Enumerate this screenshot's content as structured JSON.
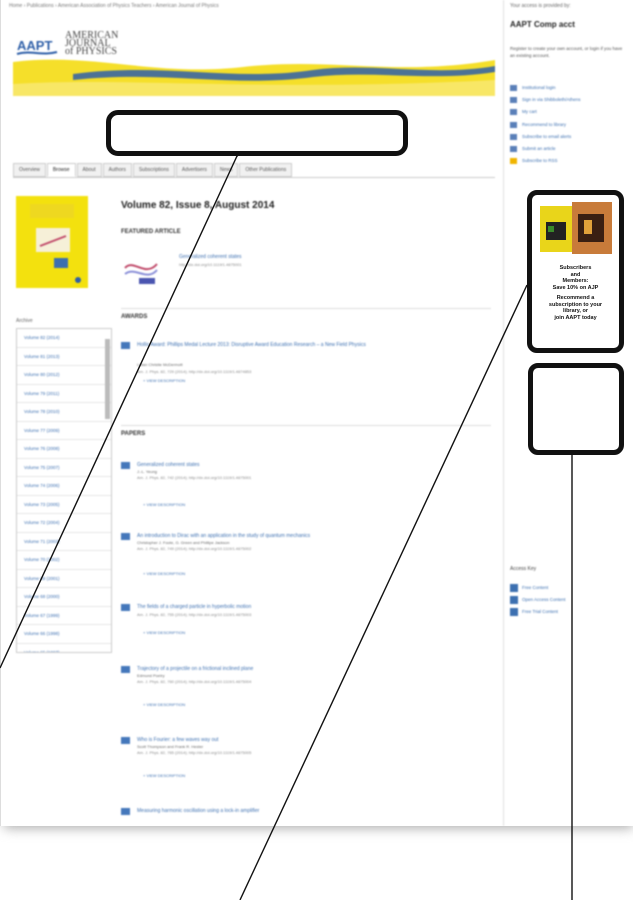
{
  "breadcrumb": "Home › Publications › American Association of Physics Teachers › American Journal of Physics",
  "journal": {
    "logo_text": "AAPT",
    "name_lines": [
      "AMERICAN",
      "JOURNAL",
      "of PHYSICS"
    ]
  },
  "tabs": [
    "Overview",
    "Browse",
    "About",
    "Authors",
    "Subscriptions",
    "Advertisers",
    "News",
    "Other Publications"
  ],
  "main": {
    "volume_title": "Volume 82, Issue 8, August 2014",
    "featured_heading": "FEATURED ARTICLE",
    "featured": {
      "title": "Generalized coherent states",
      "cite": "http://dx.doi.org/10.1119/1.4875001"
    },
    "awards_heading": "AWARDS",
    "award": {
      "title": "Hollis Award: Phillips Medal Lecture 2013: Disruptive Award Education Research – a New Field Physics",
      "authors": "Lillian Christie McDermott",
      "cite": "Am. J. Phys. 82, 729 (2014); http://dx.doi.org/10.1119/1.4874853",
      "view": "+ VIEW DESCRIPTION"
    },
    "papers_heading": "PAPERS",
    "papers": [
      {
        "title": "Generalized coherent states",
        "authors": "J.-L. Yeung",
        "cite": "Am. J. Phys. 82, 742 (2014); http://dx.doi.org/10.1119/1.4875001",
        "view": "+ VIEW DESCRIPTION"
      },
      {
        "title": "An introduction to Dirac with an application in the study of quantum mechanics",
        "authors": "Christopher J. Foote, G. Green and Phillipe Jackson",
        "cite": "Am. J. Phys. 82, 749 (2014); http://dx.doi.org/10.1119/1.4875002",
        "view": "+ VIEW DESCRIPTION"
      },
      {
        "title": "The fields of a charged particle in hyperbolic motion",
        "authors": "",
        "cite": "Am. J. Phys. 82, 755 (2014); http://dx.doi.org/10.1119/1.4875003",
        "view": "+ VIEW DESCRIPTION"
      },
      {
        "title": "Trajectory of a projectile on a frictional inclined plane",
        "authors": "Edmund Poetry",
        "cite": "Am. J. Phys. 82, 760 (2014); http://dx.doi.org/10.1119/1.4875004",
        "view": "+ VIEW DESCRIPTION"
      },
      {
        "title": "Who is Fourier: a few waves way out",
        "authors": "Scott Thompson and Frank R. Hester",
        "cite": "Am. J. Phys. 82, 765 (2014); http://dx.doi.org/10.1119/1.4875005",
        "view": "+ VIEW DESCRIPTION"
      },
      {
        "title": "Measuring harmonic oscillation using a lock-in amplifier",
        "authors": "",
        "cite": "",
        "view": ""
      }
    ]
  },
  "archive": {
    "heading": "Archive",
    "items": [
      "Volume 82 (2014)",
      "Volume 81 (2013)",
      "Volume 80 (2012)",
      "Volume 79 (2011)",
      "Volume 78 (2010)",
      "Volume 77 (2009)",
      "Volume 76 (2008)",
      "Volume 75 (2007)",
      "Volume 74 (2006)",
      "Volume 73 (2005)",
      "Volume 72 (2004)",
      "Volume 71 (2003)",
      "Volume 70 (2002)",
      "Volume 69 (2001)",
      "Volume 68 (2000)",
      "Volume 67 (1999)",
      "Volume 66 (1998)",
      "Volume 65 (1997)"
    ]
  },
  "sidebar": {
    "access_heading": "Your access is provided by:",
    "account": "AAPT Comp acct",
    "text": "Register to create your own account, or login if you have an existing account.",
    "links": [
      "Institutional login",
      "Sign in via Shibboleth/Athens",
      "My cart",
      "Recommend to library",
      "Subscribe to email alerts",
      "Submit an article",
      "Subscribe to RSS"
    ],
    "promo_lines": [
      "Subscribers",
      "and",
      "Members:",
      "Save 10% on AJP",
      "Recommend a",
      "subscription to your",
      "library, or",
      "join AAPT today"
    ],
    "key_heading": "Access Key",
    "key_items": [
      "Free Content",
      "Open Access Content",
      "Free Trial Content"
    ]
  },
  "colors": {
    "header_yellow": "#f5df2a",
    "header_blue": "#2e5fa8",
    "link": "#3c6fb0",
    "callout": "#111111"
  }
}
